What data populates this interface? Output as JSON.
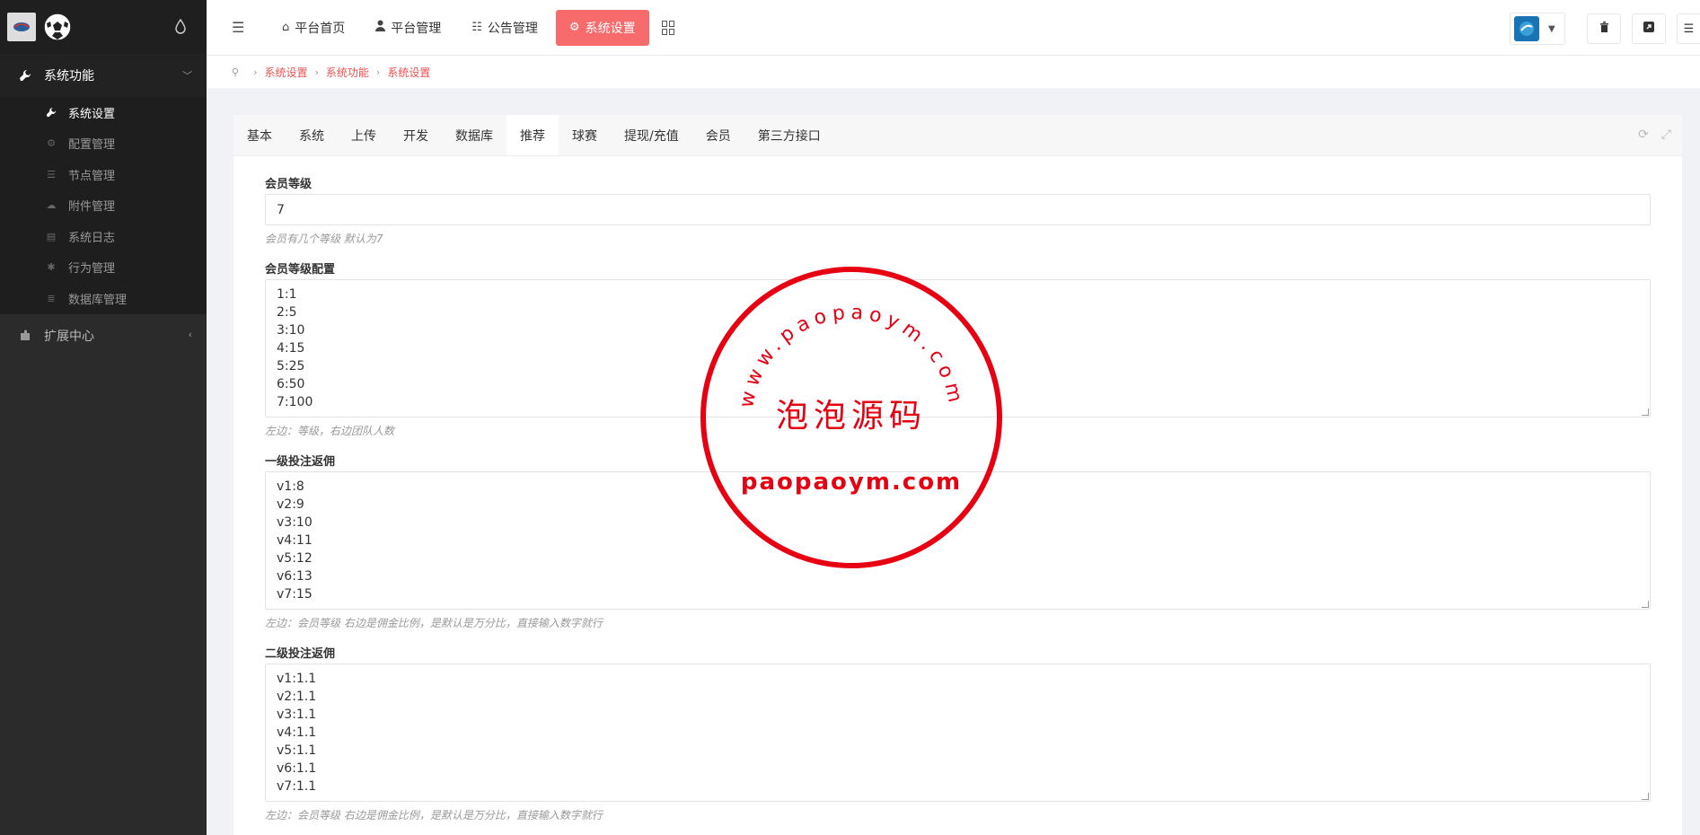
{
  "sidebar": {
    "groups": [
      {
        "label": "系统功能",
        "icon": "wrench-icon",
        "items": [
          {
            "label": "系统设置",
            "icon": "wrench-icon",
            "active": true
          },
          {
            "label": "配置管理",
            "icon": "cogs-icon"
          },
          {
            "label": "节点管理",
            "icon": "list-icon"
          },
          {
            "label": "附件管理",
            "icon": "cloud-upload-icon"
          },
          {
            "label": "系统日志",
            "icon": "book-icon"
          },
          {
            "label": "行为管理",
            "icon": "bug-icon"
          },
          {
            "label": "数据库管理",
            "icon": "database-icon"
          }
        ]
      },
      {
        "label": "扩展中心",
        "icon": "puzzle-icon"
      }
    ]
  },
  "topnav": {
    "items": [
      {
        "label": "平台首页",
        "icon": "home-icon"
      },
      {
        "label": "平台管理",
        "icon": "user-icon"
      },
      {
        "label": "公告管理",
        "icon": "list-icon"
      },
      {
        "label": "系统设置",
        "icon": "gear-icon",
        "active": true
      }
    ]
  },
  "breadcrumb": [
    "系统设置",
    "系统功能",
    "系统设置"
  ],
  "tabs": [
    "基本",
    "系统",
    "上传",
    "开发",
    "数据库",
    "推荐",
    "球赛",
    "提现/充值",
    "会员",
    "第三方接口"
  ],
  "active_tab": "推荐",
  "form": {
    "member_level": {
      "label": "会员等级",
      "value": "7",
      "help": "会员有几个等级 默认为7"
    },
    "level_config": {
      "label": "会员等级配置",
      "lines": [
        "1:1",
        "2:5",
        "3:10",
        "4:15",
        "5:25",
        "6:50",
        "7:100"
      ],
      "help": "左边：等级，右边团队人数"
    },
    "rebate_1": {
      "label": "一级投注返佣",
      "lines": [
        "v1:8",
        "v2:9",
        "v3:10",
        "v4:11",
        "v5:12",
        "v6:13",
        "v7:15"
      ],
      "help": "左边：会员等级 右边是佣金比例，是默认是万分比，直接输入数字就行"
    },
    "rebate_2": {
      "label": "二级投注返佣",
      "lines": [
        "v1:1.1",
        "v2:1.1",
        "v3:1.1",
        "v4:1.1",
        "v5:1.1",
        "v6:1.1",
        "v7:1.1"
      ],
      "help": "左边：会员等级 右边是佣金比例，是默认是万分比，直接输入数字就行"
    }
  },
  "watermark": {
    "url_text": "www.paopaoym.com",
    "cn_text": "泡泡源码",
    "domain_text": "paopaoym.com",
    "color": "#e60012"
  },
  "colors": {
    "accent": "#f76b6d",
    "sidebar_bg": "#2b2b2b",
    "link": "#f05050"
  }
}
